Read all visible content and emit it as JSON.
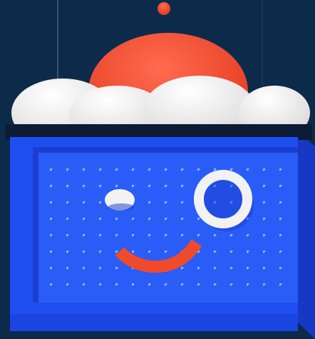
{
  "scene": {
    "subject": "winking-box-character",
    "colors": {
      "background": "#0c2a4a",
      "box_front": "#1f4ef0",
      "box_side": "#1638c4",
      "box_panel": "#2a5cf7",
      "dots": "#8fb4ff",
      "lid": "#0d1b35",
      "sun": "#f24a2c",
      "clouds": "#eeeeee",
      "eye": "#f2f2f2",
      "smile": "#f04a2a"
    },
    "icons": [
      "sun-icon",
      "cloud-icon",
      "winking-eye-icon",
      "open-eye-icon",
      "smile-icon"
    ]
  }
}
